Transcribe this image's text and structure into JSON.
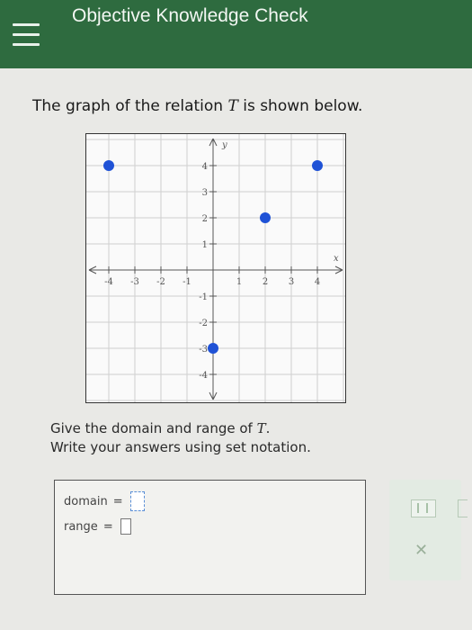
{
  "header": {
    "title": "Objective Knowledge Check",
    "menu_icon": "hamburger-menu-icon",
    "background_color": "#2e6b3f"
  },
  "question": {
    "prompt_before": "The graph of the relation ",
    "prompt_var": "T",
    "prompt_after": " is shown below.",
    "instruction_1_before": "Give the domain and range of ",
    "instruction_1_var": "T",
    "instruction_1_after": ".",
    "instruction_2": "Write your answers using set notation."
  },
  "chart_data": {
    "type": "scatter",
    "title": "",
    "xlabel": "x",
    "ylabel": "y",
    "xlim": [
      -4,
      4
    ],
    "ylim": [
      -4,
      4
    ],
    "x_ticks": [
      "-4",
      "-3",
      "-2",
      "-1",
      "1",
      "2",
      "3",
      "4"
    ],
    "y_ticks": [
      "4",
      "3",
      "2",
      "1",
      "-1",
      "-2",
      "-3",
      "-4"
    ],
    "grid": true,
    "points": [
      {
        "x": -4,
        "y": 4
      },
      {
        "x": 4,
        "y": 4
      },
      {
        "x": 2,
        "y": 2
      },
      {
        "x": 0,
        "y": -3
      }
    ],
    "point_color": "#1f52d6"
  },
  "answers": {
    "domain_label": "domain",
    "range_label": "range",
    "equals": "=",
    "domain_value": "",
    "range_value": ""
  },
  "tools": {
    "set_brace_icon": "set-braces-icon",
    "clear_icon": "clear-x-icon",
    "clear_glyph": "✕"
  }
}
